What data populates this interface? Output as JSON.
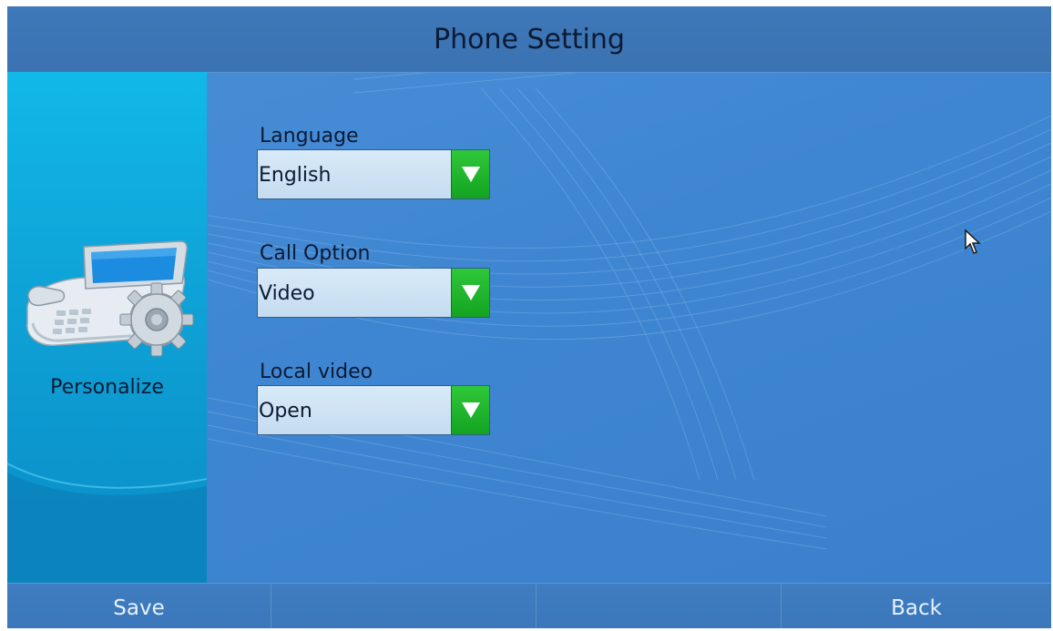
{
  "header": {
    "title": "Phone Setting"
  },
  "sidebar": {
    "label": "Personalize",
    "icon": "desk-phone-gear-icon"
  },
  "form": {
    "fields": [
      {
        "label": "Language",
        "value": "English"
      },
      {
        "label": "Call Option",
        "value": "Video"
      },
      {
        "label": "Local video",
        "value": "Open"
      }
    ]
  },
  "footer": {
    "softkeys": [
      "Save",
      "",
      "",
      "Back"
    ]
  },
  "colors": {
    "background": "#3f86d2",
    "header": "#3a72b2",
    "sidebar": "#0fa6da",
    "dropdown_button": "#14a321",
    "dropdown_field": "#c5dcf0"
  }
}
